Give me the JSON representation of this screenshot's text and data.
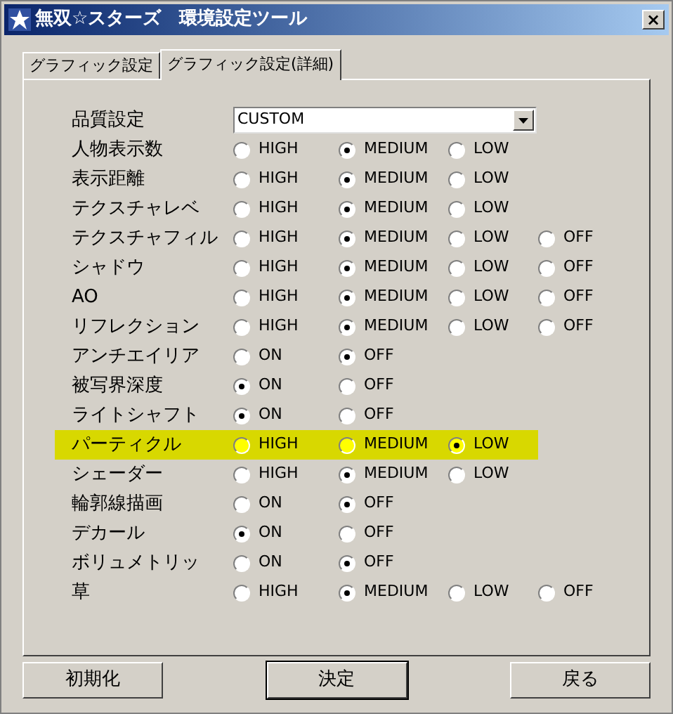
{
  "window": {
    "title": "無双☆スターズ　環境設定ツール",
    "close": "×"
  },
  "tabs": [
    {
      "label": "グラフィック設定",
      "selected": false
    },
    {
      "label": "グラフィック設定(詳細)",
      "selected": true
    }
  ],
  "settings": [
    {
      "kind": "select",
      "label": "品質設定",
      "value": "CUSTOM"
    },
    {
      "kind": "radio",
      "label": "人物表示数",
      "highlighted": false,
      "options": [
        {
          "label": "HIGH",
          "selected": false
        },
        {
          "label": "MEDIUM",
          "selected": true
        },
        {
          "label": "LOW",
          "selected": false
        }
      ]
    },
    {
      "kind": "radio",
      "label": "表示距離",
      "highlighted": false,
      "options": [
        {
          "label": "HIGH",
          "selected": false
        },
        {
          "label": "MEDIUM",
          "selected": true
        },
        {
          "label": "LOW",
          "selected": false
        }
      ]
    },
    {
      "kind": "radio",
      "label": "テクスチャレベ",
      "highlighted": false,
      "options": [
        {
          "label": "HIGH",
          "selected": false
        },
        {
          "label": "MEDIUM",
          "selected": true
        },
        {
          "label": "LOW",
          "selected": false
        }
      ]
    },
    {
      "kind": "radio",
      "label": "テクスチャフィル",
      "highlighted": false,
      "options": [
        {
          "label": "HIGH",
          "selected": false
        },
        {
          "label": "MEDIUM",
          "selected": true
        },
        {
          "label": "LOW",
          "selected": false
        },
        {
          "label": "OFF",
          "selected": false
        }
      ]
    },
    {
      "kind": "radio",
      "label": "シャドウ",
      "highlighted": false,
      "options": [
        {
          "label": "HIGH",
          "selected": false
        },
        {
          "label": "MEDIUM",
          "selected": true
        },
        {
          "label": "LOW",
          "selected": false
        },
        {
          "label": "OFF",
          "selected": false
        }
      ]
    },
    {
      "kind": "radio",
      "label": "AO",
      "highlighted": false,
      "options": [
        {
          "label": "HIGH",
          "selected": false
        },
        {
          "label": "MEDIUM",
          "selected": true
        },
        {
          "label": "LOW",
          "selected": false
        },
        {
          "label": "OFF",
          "selected": false
        }
      ]
    },
    {
      "kind": "radio",
      "label": "リフレクション",
      "highlighted": false,
      "options": [
        {
          "label": "HIGH",
          "selected": false
        },
        {
          "label": "MEDIUM",
          "selected": true
        },
        {
          "label": "LOW",
          "selected": false
        },
        {
          "label": "OFF",
          "selected": false
        }
      ]
    },
    {
      "kind": "radio",
      "label": "アンチエイリア",
      "highlighted": false,
      "options": [
        {
          "label": "ON",
          "selected": false
        },
        {
          "label": "OFF",
          "selected": true
        }
      ]
    },
    {
      "kind": "radio",
      "label": "被写界深度",
      "highlighted": false,
      "options": [
        {
          "label": "ON",
          "selected": true
        },
        {
          "label": "OFF",
          "selected": false
        }
      ]
    },
    {
      "kind": "radio",
      "label": "ライトシャフト",
      "highlighted": false,
      "options": [
        {
          "label": "ON",
          "selected": true
        },
        {
          "label": "OFF",
          "selected": false
        }
      ]
    },
    {
      "kind": "radio",
      "label": "パーティクル",
      "highlighted": true,
      "options": [
        {
          "label": "HIGH",
          "selected": false
        },
        {
          "label": "MEDIUM",
          "selected": false
        },
        {
          "label": "LOW",
          "selected": true
        }
      ]
    },
    {
      "kind": "radio",
      "label": "シェーダー",
      "highlighted": false,
      "options": [
        {
          "label": "HIGH",
          "selected": false
        },
        {
          "label": "MEDIUM",
          "selected": true
        },
        {
          "label": "LOW",
          "selected": false
        }
      ]
    },
    {
      "kind": "radio",
      "label": "輪郭線描画",
      "highlighted": false,
      "options": [
        {
          "label": "ON",
          "selected": false
        },
        {
          "label": "OFF",
          "selected": true
        }
      ]
    },
    {
      "kind": "radio",
      "label": "デカール",
      "highlighted": false,
      "options": [
        {
          "label": "ON",
          "selected": true
        },
        {
          "label": "OFF",
          "selected": false
        }
      ]
    },
    {
      "kind": "radio",
      "label": "ボリュメトリッ",
      "highlighted": false,
      "options": [
        {
          "label": "ON",
          "selected": false
        },
        {
          "label": "OFF",
          "selected": true
        }
      ]
    },
    {
      "kind": "radio",
      "label": "草",
      "highlighted": false,
      "options": [
        {
          "label": "HIGH",
          "selected": false
        },
        {
          "label": "MEDIUM",
          "selected": true
        },
        {
          "label": "LOW",
          "selected": false
        },
        {
          "label": "OFF",
          "selected": false
        }
      ]
    }
  ],
  "buttons": [
    "初期化",
    "決定",
    "戻る"
  ]
}
